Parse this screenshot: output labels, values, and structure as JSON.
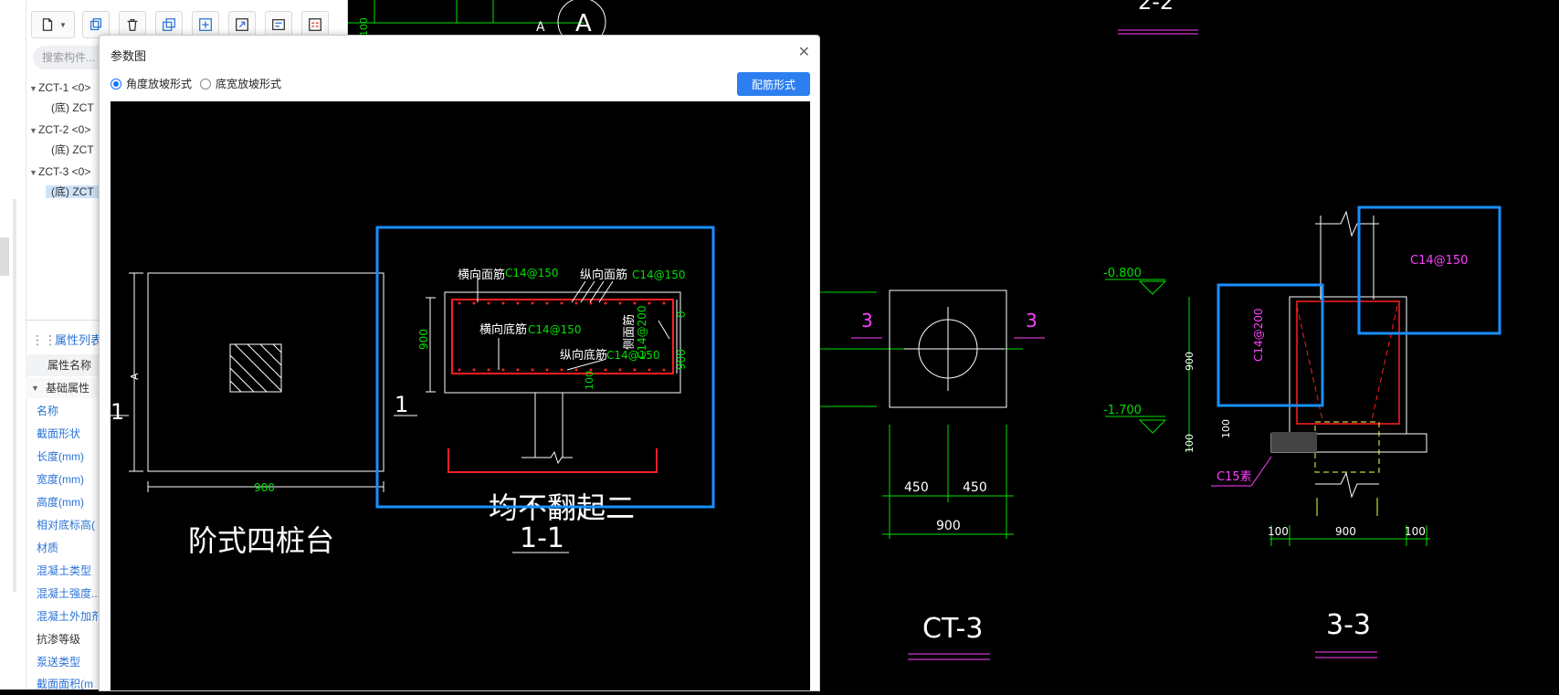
{
  "colors": {
    "accent": "#2d7ff0",
    "cad_green": "#00e000",
    "cad_red": "#ff2020",
    "cad_magenta": "#ff40ff",
    "cad_blue_box": "#1890ff",
    "cad_white": "#ffffff"
  },
  "left_panel": {
    "search_placeholder": "搜索构件...",
    "toolbar_icons": [
      "new-file-icon",
      "dropdown-icon",
      "copy-icon",
      "delete-icon",
      "duplicate-icon",
      "import-icon",
      "export-icon",
      "layer-icon",
      "table-icon"
    ],
    "tree": [
      {
        "label": "ZCT-1 <0>",
        "child": "(底) ZCT"
      },
      {
        "label": "ZCT-2 <0>",
        "child": "(底) ZCT"
      },
      {
        "label": "ZCT-3 <0>",
        "child": "(底) ZCT"
      }
    ],
    "attr_tab": "属性列表",
    "attr_header": "属性名称",
    "attr_group": "基础属性",
    "attr_rows": [
      "名称",
      "截面形状",
      "长度(mm)",
      "宽度(mm)",
      "高度(mm)",
      "相对底标高(",
      "材质",
      "混凝土类型",
      "混凝土强度...",
      "混凝土外加剂",
      "抗渗等级",
      "泵送类型",
      "截面面积(m"
    ]
  },
  "dialog": {
    "title": "参数图",
    "radio_options": [
      {
        "label": "角度放坡形式",
        "selected": true
      },
      {
        "label": "底宽放坡形式",
        "selected": false
      }
    ],
    "button_label": "配筋形式",
    "plan": {
      "dim_width": "900",
      "dim_a": "A",
      "label_left": "1",
      "label_right": "1",
      "title": "阶式四桩台"
    },
    "section": {
      "top_bar_label": "横向面筋",
      "top_bar_spec": "C14@150",
      "long_top_label": "纵向面筋",
      "long_top_spec": "C14@150",
      "bottom_bar_label": "横向底筋",
      "bottom_bar_spec": "C14@150",
      "long_bottom_label": "纵向底筋",
      "long_bottom_spec": "C14@150",
      "side_label": "侧面筋",
      "side_spec": "C14@200",
      "dim_height": "900",
      "dim_right_top": "0",
      "dim_right": "900",
      "dim_bottom": "100",
      "note": "均不翻起二",
      "section_title": "1-1"
    }
  },
  "background_cad": {
    "top_a": "A",
    "top_dim": "100",
    "top_title": "2-2",
    "ct3": {
      "label_left": "3",
      "label_right": "3",
      "dim_a": "450",
      "dim_b": "450",
      "dim_total": "900",
      "title": "CT-3"
    },
    "s33": {
      "elev_top": "-0.800",
      "elev_bottom": "-1.700",
      "dim_h": "900",
      "dim_b1": "100",
      "dim_b2": "100",
      "concrete": "C15素",
      "side_spec": "C14@200",
      "top_spec": "C14@150",
      "dim_l": "100",
      "dim_m": "900",
      "dim_r": "100",
      "title": "3-3"
    }
  }
}
